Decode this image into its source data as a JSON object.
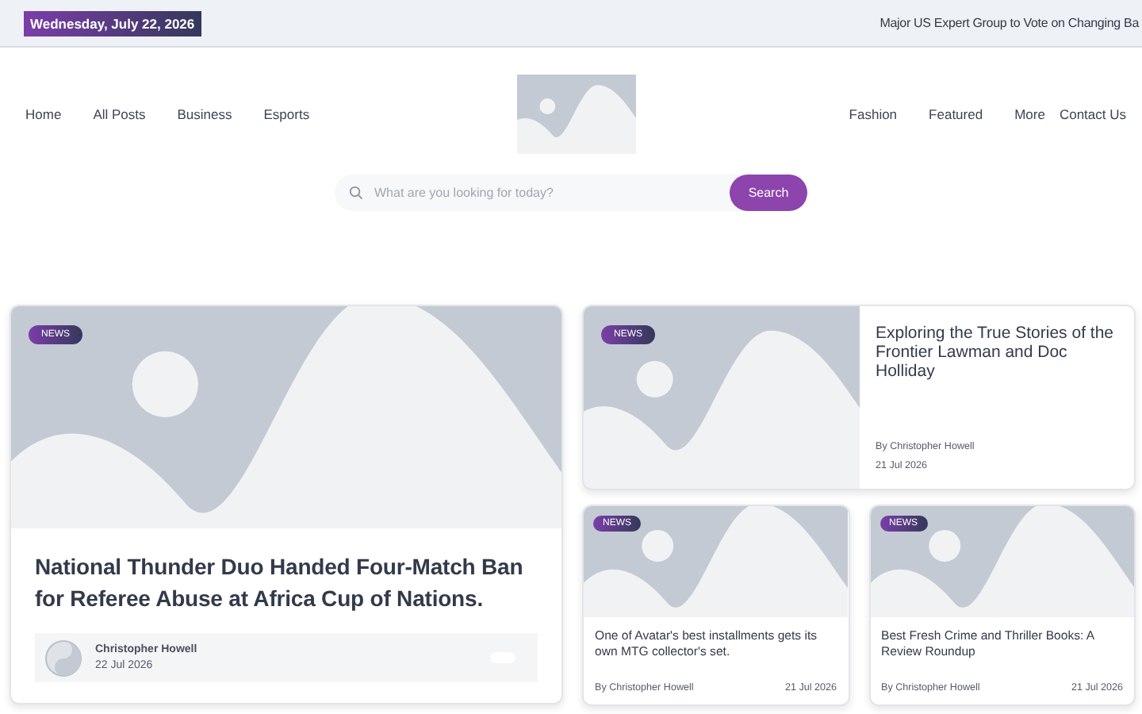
{
  "top_bar": {
    "date": "Wednesday, July 22, 2026",
    "ticker": "Major US Expert Group to Vote on Changing Ba"
  },
  "nav_left": [
    "Home",
    "All Posts",
    "Business",
    "Esports"
  ],
  "nav_right": [
    "Fashion",
    "Featured",
    "More",
    "Contact Us"
  ],
  "search": {
    "placeholder": "What are you looking for today?",
    "button": "Search"
  },
  "posts": [
    {
      "kind": "feature",
      "tag": "NEWS",
      "title": "National Thunder Duo Handed Four-Match Ban for Referee Abuse at Africa Cup of Nations.",
      "author": "Christopher Howell",
      "date": "22 Jul 2026"
    },
    {
      "kind": "horizontal",
      "tag": "NEWS",
      "title": "Exploring the True Stories of the Frontier Lawman and Doc Holliday",
      "author": "By Christopher Howell",
      "date": "21 Jul 2026"
    },
    {
      "kind": "compact",
      "tag": "NEWS",
      "title": "One of Avatar's best installments gets its own MTG collector's set.",
      "author": "By Christopher Howell",
      "date": "21 Jul 2026"
    },
    {
      "kind": "compact",
      "tag": "NEWS",
      "title": "Best Fresh Crime and Thriller Books: A Review Roundup",
      "author": "By Christopher Howell",
      "date": "21 Jul 2026"
    }
  ]
}
